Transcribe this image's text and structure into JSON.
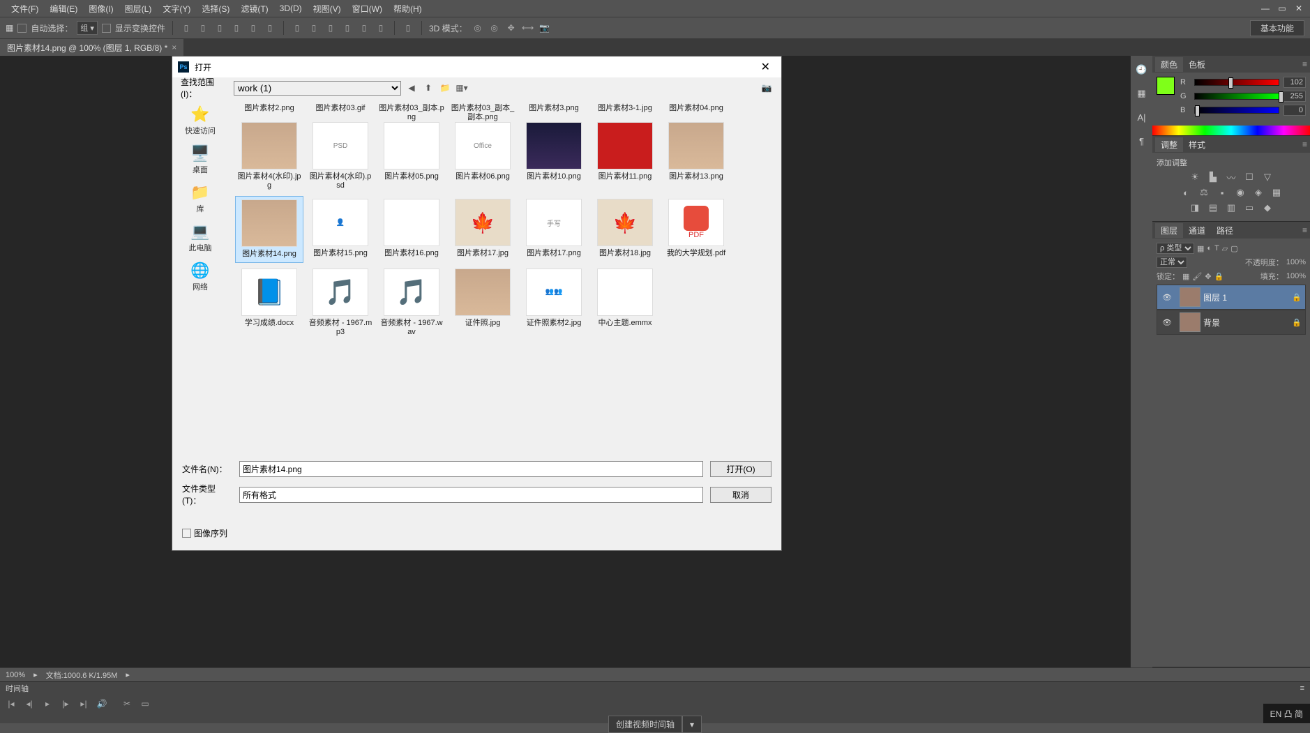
{
  "menubar": {
    "items": [
      "文件(F)",
      "编辑(E)",
      "图像(I)",
      "图层(L)",
      "文字(Y)",
      "选择(S)",
      "滤镜(T)",
      "3D(D)",
      "视图(V)",
      "窗口(W)",
      "帮助(H)"
    ]
  },
  "optionsbar": {
    "auto_select_label": "自动选择：",
    "auto_select_value": "组",
    "show_transform_label": "显示变换控件",
    "mode3d_label": "3D 模式：",
    "right_button": "基本功能"
  },
  "doctab": {
    "title": "图片素材14.png @ 100% (图层 1, RGB/8) *"
  },
  "color_panel": {
    "tab1": "颜色",
    "tab2": "色板",
    "r_label": "R",
    "r_val": "102",
    "g_label": "G",
    "g_val": "255",
    "b_label": "B",
    "b_val": "0"
  },
  "adjust_panel": {
    "tab1": "调整",
    "tab2": "样式",
    "heading": "添加调整"
  },
  "layers_panel": {
    "tab1": "图层",
    "tab2": "通道",
    "tab3": "路径",
    "filter_label": "ρ 类型",
    "blend_mode": "正常",
    "opacity_label": "不透明度：",
    "opacity_val": "100%",
    "lock_label": "锁定：",
    "fill_label": "填充：",
    "fill_val": "100%",
    "layer1_name": "图层 1",
    "layer2_name": "背景"
  },
  "statusbar": {
    "zoom": "100%",
    "docinfo": "文档:1000.6 K/1.95M"
  },
  "timeline": {
    "tab": "时间轴",
    "create_btn": "创建视频时间轴"
  },
  "taskbar": {
    "ime": "EN 凸 简"
  },
  "dialog": {
    "title": "打开",
    "lookin_label": "查找范围(I)：",
    "lookin_value": "work (1)",
    "sidebar": [
      {
        "icon": "⭐",
        "label": "快速访问",
        "color": "#0078d4"
      },
      {
        "icon": "🖥️",
        "label": "桌面",
        "color": "#0078d4"
      },
      {
        "icon": "📁",
        "label": "库",
        "color": "#f0b429"
      },
      {
        "icon": "💻",
        "label": "此电脑",
        "color": "#0078d4"
      },
      {
        "icon": "🌐",
        "label": "网络",
        "color": "#0078d4"
      }
    ],
    "files_row0": [
      {
        "name": "图片素材2.png"
      },
      {
        "name": "图片素材03.gif"
      },
      {
        "name": "图片素材03_副本.png"
      },
      {
        "name": "图片素材03_副本_副本.png"
      },
      {
        "name": "图片素材3.png"
      },
      {
        "name": "图片素材3-1.jpg"
      },
      {
        "name": "图片素材04.png"
      }
    ],
    "files": [
      {
        "name": "图片素材4(水印).jpg",
        "thumb": "img-face"
      },
      {
        "name": "图片素材4(水印).psd",
        "thumb": "img-white",
        "txt": "PSD"
      },
      {
        "name": "图片素材05.png",
        "thumb": "img-white"
      },
      {
        "name": "图片素材06.png",
        "thumb": "img-white",
        "txt": "Office"
      },
      {
        "name": "图片素材10.png",
        "thumb": "img-city"
      },
      {
        "name": "图片素材11.png",
        "thumb": "img-red"
      },
      {
        "name": "图片素材13.png",
        "thumb": "img-face"
      },
      {
        "name": "图片素材14.png",
        "thumb": "img-face",
        "selected": true
      },
      {
        "name": "图片素材15.png",
        "thumb": "img-white",
        "txt": "👤"
      },
      {
        "name": "图片素材16.png",
        "thumb": "img-white"
      },
      {
        "name": "图片素材17.jpg",
        "thumb": "img-leaf"
      },
      {
        "name": "图片素材17.png",
        "thumb": "img-white",
        "txt": "手写"
      },
      {
        "name": "图片素材18.jpg",
        "thumb": "img-leaf"
      },
      {
        "name": "我的大学规划.pdf",
        "thumb": "pdf-ic",
        "txt": "PDF"
      },
      {
        "name": "学习成绩.docx",
        "thumb": "doc-ic",
        "txt": "📘"
      },
      {
        "name": "音频素材 - 1967.mp3",
        "thumb": "doc-ic",
        "txt": "🎵"
      },
      {
        "name": "音频素材 - 1967.wav",
        "thumb": "doc-ic",
        "txt": "🎵"
      },
      {
        "name": "证件照.jpg",
        "thumb": "img-face"
      },
      {
        "name": "证件照素材2.jpg",
        "thumb": "img-white",
        "txt": "👥👥"
      },
      {
        "name": "中心主题.emmx",
        "thumb": "img-white"
      }
    ],
    "filename_label": "文件名(N)：",
    "filename_value": "图片素材14.png",
    "filetype_label": "文件类型(T)：",
    "filetype_value": "所有格式",
    "open_btn": "打开(O)",
    "cancel_btn": "取消",
    "sequence_label": "图像序列"
  }
}
